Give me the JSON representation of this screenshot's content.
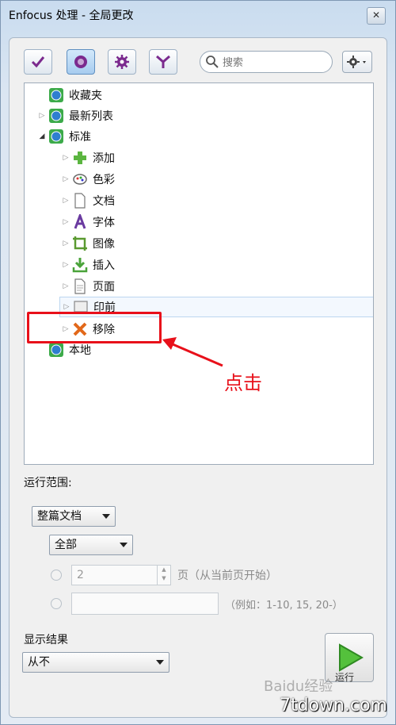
{
  "window": {
    "title": "Enfocus 处理 - 全局更改",
    "close_glyph": "✕"
  },
  "toolbar": {
    "buttons": [
      {
        "name": "check-tool-button",
        "icon": "checkmark-icon"
      },
      {
        "name": "fix-tool-button",
        "icon": "globe-icon",
        "active": true
      },
      {
        "name": "settings-tool-button",
        "icon": "gear-icon"
      },
      {
        "name": "filter-tool-button",
        "icon": "funnel-icon"
      }
    ],
    "search_placeholder": "搜索",
    "options_glyph": "⚙▾"
  },
  "tree": {
    "items": [
      {
        "label": "收藏夹",
        "icon": "globe-icon"
      },
      {
        "label": "最新列表",
        "icon": "globe-icon"
      },
      {
        "label": "标准",
        "icon": "globe-icon"
      },
      {
        "label": "添加",
        "icon": "plus-icon"
      },
      {
        "label": "色彩",
        "icon": "palette-icon"
      },
      {
        "label": "文档",
        "icon": "document-icon"
      },
      {
        "label": "字体",
        "icon": "font-icon"
      },
      {
        "label": "图像",
        "icon": "crop-icon"
      },
      {
        "label": "插入",
        "icon": "insert-icon"
      },
      {
        "label": "页面",
        "icon": "page-icon"
      },
      {
        "label": "印前",
        "icon": "prepress-icon"
      },
      {
        "label": "移除",
        "icon": "remove-x-icon"
      },
      {
        "label": "本地",
        "icon": "globe-icon"
      }
    ]
  },
  "annotation": {
    "text": "点击",
    "color": "#e8101a"
  },
  "scope": {
    "label": "运行范围:",
    "document_select": "整篇文档",
    "pages_select": "全部",
    "page_value": "2",
    "page_suffix": "页（从当前页开始）",
    "range_example": "（例如：1-10, 15, 20-）"
  },
  "results": {
    "label": "显示结果",
    "select": "从不"
  },
  "run_button": {
    "icon": "play-icon",
    "label": "运行"
  },
  "watermarks": {
    "baidu": "Baidu经验",
    "site": "7tdown.com"
  }
}
